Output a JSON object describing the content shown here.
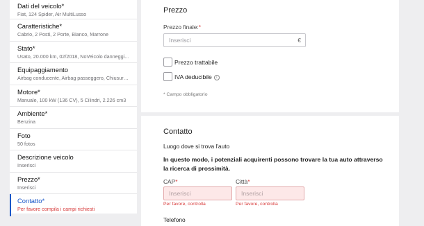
{
  "sidebar": {
    "items": [
      {
        "label": "Dati del veicolo*",
        "sub": "Fiat, 124 Spider, Air MultiLusso"
      },
      {
        "label": "Caratteristiche*",
        "sub": "Cabrio, 2 Posti, 2 Porte, Bianco, Marrone"
      },
      {
        "label": "Stato*",
        "sub": "Usato, 20.000 km, 02/2018, NoVeicolo danneggi..."
      },
      {
        "label": "Equipaggiamento",
        "sub": "Airbag conducente, Airbag passeggero, Chiusura..."
      },
      {
        "label": "Motore*",
        "sub": "Manuale, 100 kW (136 CV), 5 Cilindri, 2.226 cm3"
      },
      {
        "label": "Ambiente*",
        "sub": "Benzina"
      },
      {
        "label": "Foto",
        "sub": "50 fotos"
      },
      {
        "label": "Descrizione veicolo",
        "sub": "Inserisci"
      },
      {
        "label": "Prezzo*",
        "sub": "Inserisci"
      },
      {
        "label": "Contatto*",
        "sub": "Per favore compila i campi richiesti"
      }
    ]
  },
  "price": {
    "title": "Prezzo",
    "final_label": "Prezzo finale:",
    "required_mark": "*",
    "placeholder": "Inserisci",
    "currency": "€",
    "negotiable_label": "Prezzo trattabile",
    "vat_label": "IVA deducibile",
    "info_glyph": "i",
    "required_note": "* Campo obbligatorio"
  },
  "contact": {
    "title": "Contatto",
    "location_heading": "Luogo dove si trova l'auto",
    "description": "In questo modo, i potenziali acquirenti possono trovare la tua auto attraverso la ricerca di prossimità.",
    "cap_label": "CAP",
    "city_label": "Città",
    "required_mark": "*",
    "cap_placeholder": "Inserisci",
    "city_placeholder": "Inserisci",
    "cap_error": "Per favore, controlla",
    "city_error": "Per favore, controlla",
    "phone_label": "Telefono"
  },
  "colors": {
    "accent": "#1a57c8",
    "error": "#d73a3a",
    "error_bg": "#fde8e8"
  }
}
